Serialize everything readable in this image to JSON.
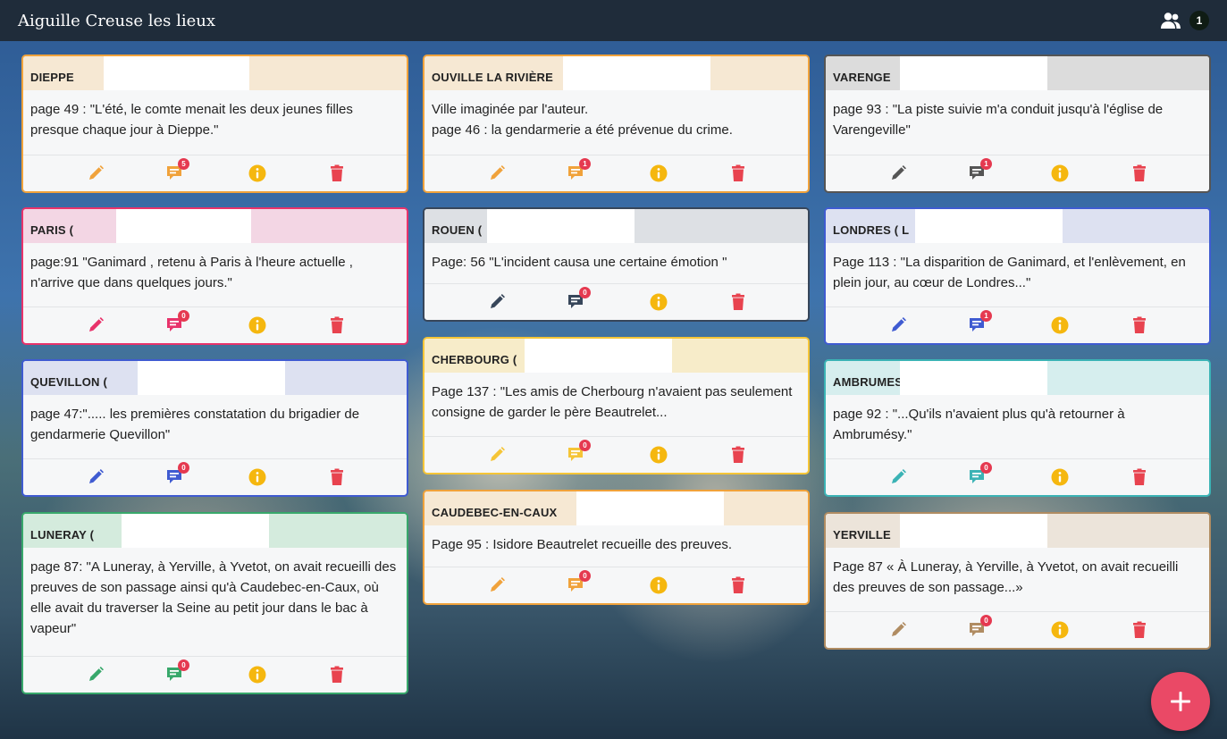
{
  "app": {
    "title": "Aiguille Creuse les lieux",
    "users_online": "1"
  },
  "icons": {
    "users": "users-icon",
    "edit": "pencil-icon",
    "comments": "comment-icon",
    "info": "info-icon",
    "delete": "trash-icon",
    "add": "plus-icon"
  },
  "colors": {
    "topbar": "#1f2c3a",
    "fab": "#ea4966",
    "info": "#f5b70f",
    "delete": "#e8434f"
  },
  "cards": [
    {
      "title": "DIEPPE",
      "text": "page 49 : \"L'été, le comte menait les deux jeunes filles presque chaque jour à Dieppe.\"",
      "comments": "5",
      "accent": "#f0a23b",
      "header_bg": "#f6e8d3"
    },
    {
      "title": "PARIS (",
      "text": "page:91 \"Ganimard , retenu à Paris à l'heure actuelle , n'arrive que dans quelques jours.\"",
      "comments": "0",
      "accent": "#e8336b",
      "header_bg": "#f3d6e4"
    },
    {
      "title": "QUEVILLON (",
      "text": "page 47:\"..... les premières constatation du brigadier de gendarmerie Quevillon\"",
      "comments": "0",
      "accent": "#3f5bd1",
      "header_bg": "#dde1f1"
    },
    {
      "title": "LUNERAY (",
      "text": "page 87: \"A Luneray, à Yerville, à Yvetot, on avait recueilli des preuves de son passage ainsi qu'à Caudebec-en-Caux, où elle avait du traverser la Seine au petit jour dans le bac à vapeur\"",
      "comments": "0",
      "accent": "#38a86b",
      "header_bg": "#d4ebdd"
    },
    {
      "title": "OUVILLE LA RIVIÈRE",
      "text": "Ville imaginée par l'auteur.\npage 46 : la gendarmerie a été prévenue du crime.",
      "comments": "1",
      "accent": "#f0a23b",
      "header_bg": "#f6e8d3"
    },
    {
      "title": "ROUEN (",
      "text": "Page: 56 \"L'incident causa une certaine émotion \"",
      "comments": "0",
      "accent": "#37465a",
      "header_bg": "#dde0e4"
    },
    {
      "title": "CHERBOURG (",
      "text": "Page 137 : \"Les amis de Cherbourg n'avaient pas seulement consigne de garder le père Beautrelet...",
      "comments": "0",
      "accent": "#f5c537",
      "header_bg": "#f7ecc9"
    },
    {
      "title": "CAUDEBEC-EN-CAUX",
      "text": "Page 95 : Isidore Beautrelet recueille des preuves.",
      "comments": "0",
      "accent": "#f0a23b",
      "header_bg": "#f6e8d3"
    },
    {
      "title": "VARENGE",
      "text": "page 93 : \"La piste suivie m'a conduit jusqu'à l'église de Varengeville\"",
      "comments": "1",
      "accent": "#555555",
      "header_bg": "#dcdcdc"
    },
    {
      "title": "LONDRES ( L",
      "text": "Page 113 : \"La disparition de Ganimard, et l'enlèvement, en plein jour, au cœur de Londres...\"",
      "comments": "1",
      "accent": "#3f5bd1",
      "header_bg": "#dde1f1"
    },
    {
      "title": "AMBRUMES",
      "text": "page 92 : \"...Qu'ils n'avaient plus qu'à retourner à Ambrumésy.\"",
      "comments": "0",
      "accent": "#3bb3b5",
      "header_bg": "#d6eeee"
    },
    {
      "title": "YERVILLE",
      "text": "Page 87 « À Luneray, à Yerville, à Yvetot, on avait recueilli des preuves de son passage...»",
      "comments": "0",
      "accent": "#b08c62",
      "header_bg": "#ece4da"
    }
  ]
}
